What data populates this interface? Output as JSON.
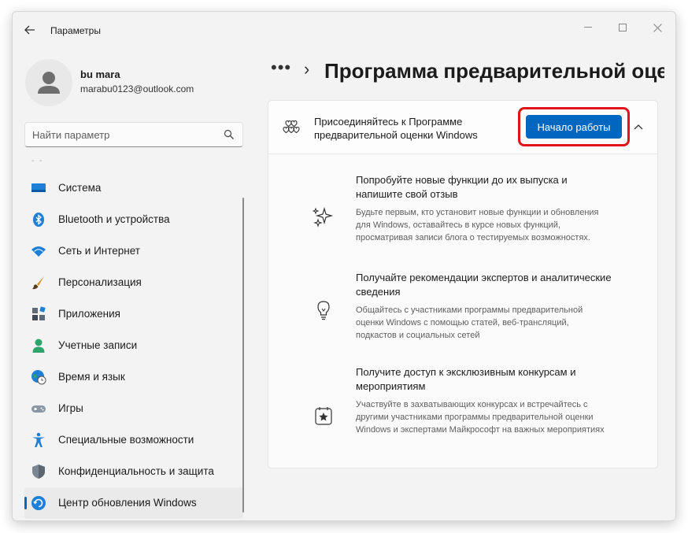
{
  "window": {
    "title": "Параметры"
  },
  "profile": {
    "name": "bu mara",
    "email": "marabu0123@outlook.com"
  },
  "search": {
    "placeholder": "Найти параметр"
  },
  "sidebar": {
    "items": [
      {
        "label": "Система",
        "icon": "system-display-icon"
      },
      {
        "label": "Bluetooth и устройства",
        "icon": "bluetooth-icon"
      },
      {
        "label": "Сеть и Интернет",
        "icon": "wifi-icon"
      },
      {
        "label": "Персонализация",
        "icon": "brush-icon"
      },
      {
        "label": "Приложения",
        "icon": "apps-icon"
      },
      {
        "label": "Учетные записи",
        "icon": "person-icon"
      },
      {
        "label": "Время и язык",
        "icon": "globe-clock-icon"
      },
      {
        "label": "Игры",
        "icon": "gamepad-icon"
      },
      {
        "label": "Специальные возможности",
        "icon": "accessibility-icon"
      },
      {
        "label": "Конфиденциальность и защита",
        "icon": "shield-icon"
      },
      {
        "label": "Центр обновления Windows",
        "icon": "windows-update-icon",
        "active": true
      }
    ]
  },
  "breadcrumb": {
    "more": "•••",
    "separator": "›",
    "title": "Программа предварительной оценки Windows"
  },
  "insider": {
    "header_text": "Присоединяйтесь к Программе предварительной оценки Windows",
    "start_button": "Начало работы",
    "features": [
      {
        "title": "Попробуйте новые функции до их выпуска и напишите свой отзыв",
        "description": "Будьте первым, кто установит новые функции и обновления для Windows, оставайтесь в курсе новых функций, просматривая записи блога о тестируемых возможностях.",
        "icon": "sparkle-icon"
      },
      {
        "title": "Получайте рекомендации экспертов и аналитические сведения",
        "description": "Общайтесь с участниками программы предварительной оценки Windows с помощью статей, веб-трансляций, подкастов и социальных сетей",
        "icon": "lightbulb-icon"
      },
      {
        "title": "Получите доступ к эксклюзивным конкурсам и мероприятиям",
        "description": "Участвуйте в захватывающих конкурсах и встречайтесь с другими участниками программы предварительной оценки Windows и экспертами Майкрософт на важных мероприятиях",
        "icon": "star-badge-icon"
      }
    ]
  },
  "colors": {
    "accent": "#0067c0",
    "highlight": "#e0151b"
  }
}
